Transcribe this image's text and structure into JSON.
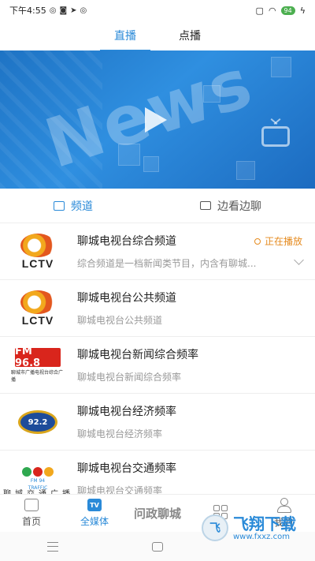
{
  "status_bar": {
    "time": "下午4:55",
    "battery": "94"
  },
  "top_tabs": [
    {
      "label": "直播",
      "active": true
    },
    {
      "label": "点播",
      "active": false
    }
  ],
  "banner": {
    "word": "News"
  },
  "sub_tabs": [
    {
      "label": "频道",
      "icon": "channel-icon",
      "active": true
    },
    {
      "label": "边看边聊",
      "icon": "chat-icon",
      "active": false
    }
  ],
  "channels": [
    {
      "title": "聊城电视台综合频道",
      "desc": "综合频道是一档新闻类节目，内含有聊城...",
      "status": "正在播放",
      "logo_text": "LCTV"
    },
    {
      "title": "聊城电视台公共频道",
      "desc": "聊城电视台公共频道",
      "logo_text": "LCTV"
    },
    {
      "title": "聊城电视台新闻综合频率",
      "desc": "聊城电视台新闻综合频率",
      "logo_text": "FM 96.8",
      "logo_sub": "聊城市广播电视台综合广播"
    },
    {
      "title": "聊城电视台经济频率",
      "desc": "聊城电视台经济频率",
      "logo_text": "92.2"
    },
    {
      "title": "聊城电视台交通频率",
      "desc": "聊城电视台交通频率",
      "logo_text": "FM 94",
      "logo_sub": "TRAFFIC"
    }
  ],
  "partial_caption": "聊城交通广播",
  "bottom_nav": [
    {
      "label": "首页",
      "icon": "home-icon",
      "active": false
    },
    {
      "label": "全媒体",
      "icon": "tv-icon",
      "icon_text": "TV",
      "active": true
    },
    {
      "label": "问政聊城",
      "icon": "wenzheng-logo",
      "active": false
    },
    {
      "label": "",
      "icon": "grid-icon",
      "active": false
    },
    {
      "label": "我的",
      "icon": "profile-icon",
      "active": false
    }
  ],
  "watermark": {
    "main": "飞翔下载",
    "url": "www.fxxz.com",
    "badge": "飞"
  },
  "colors": {
    "accent": "#2a8ad8",
    "live_status": "#e58a1e",
    "banner_blue": "#2f8fe0"
  }
}
